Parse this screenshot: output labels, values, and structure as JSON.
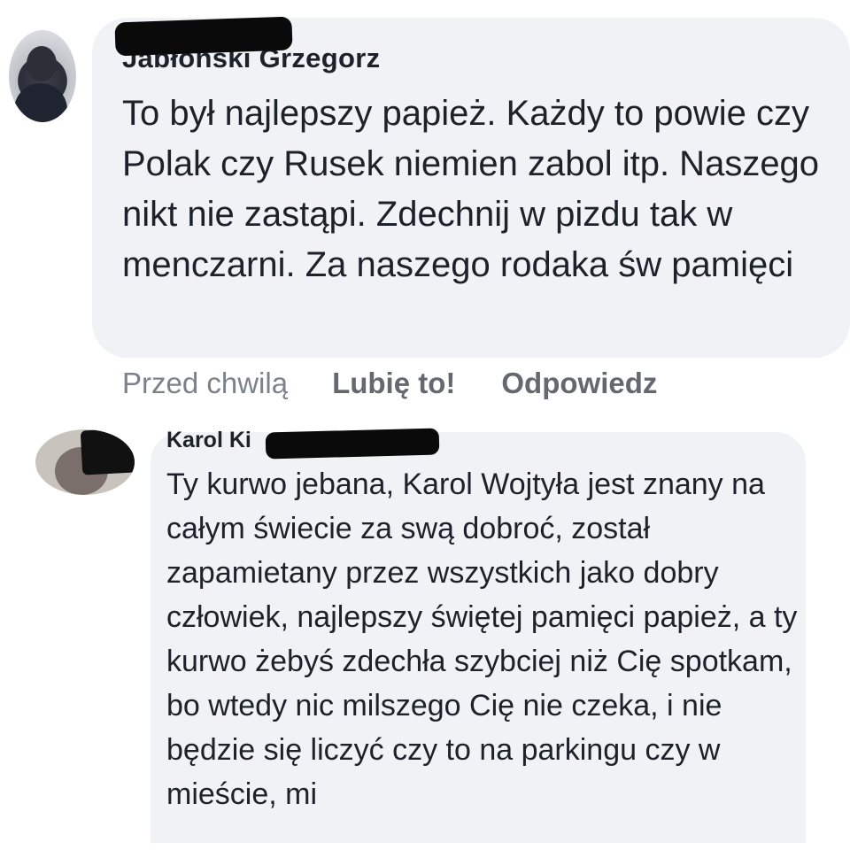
{
  "comments": [
    {
      "author": "Jabłoński Grzegorz",
      "text": "To był najlepszy papież. Każdy to powie czy Polak czy Rusek niemien zabol itp. Naszego nikt nie zastąpi. Zdechnij w pizdu tak w menczarni. Za naszego rodaka św pamięci",
      "timestamp": "Przed chwilą",
      "like_label": "Lubię to!",
      "reply_label": "Odpowiedz"
    },
    {
      "author": "Karol Ki",
      "text": "Ty kurwo jebana, Karol Wojtyła jest znany na całym świecie za swą dobroć, został zapamietany przez wszystkich jako dobry człowiek, najlepszy świętej pamięci papież, a ty kurwo żebyś zdechła szybciej niż Cię spotkam, bo wtedy nic milszego Cię nie czeka, i nie będzie się liczyć czy to na parkingu czy w mieście, mi"
    }
  ],
  "colors": {
    "bubble_bg": "#f1f2f6",
    "text": "#1d2129",
    "meta": "#7d818a",
    "action": "#65686e"
  }
}
